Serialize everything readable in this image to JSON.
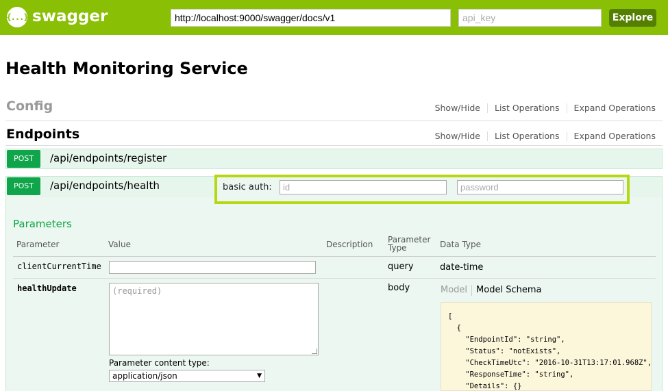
{
  "header": {
    "logo_glyph": "{...}",
    "brand": "swagger",
    "url_value": "http://localhost:9000/swagger/docs/v1",
    "api_key_placeholder": "api_key",
    "explore_label": "Explore",
    "brand_color": "#89bf04"
  },
  "page_title": "Health Monitoring Service",
  "resources": [
    {
      "title": "Config",
      "links": [
        "Show/Hide",
        "List Operations",
        "Expand Operations"
      ]
    },
    {
      "title": "Endpoints",
      "links": [
        "Show/Hide",
        "List Operations",
        "Expand Operations"
      ]
    }
  ],
  "operations": [
    {
      "method": "POST",
      "path": "/api/endpoints/register"
    },
    {
      "method": "POST",
      "path": "/api/endpoints/health"
    }
  ],
  "basic_auth": {
    "label": "basic auth:",
    "id_placeholder": "id",
    "password_placeholder": "password"
  },
  "parameters": {
    "title": "Parameters",
    "headers": [
      "Parameter",
      "Value",
      "Description",
      "Parameter Type",
      "Data Type"
    ],
    "rows": [
      {
        "name": "clientCurrentTime",
        "value": "",
        "description": "",
        "param_type": "query",
        "data_type": "date-time"
      },
      {
        "name": "healthUpdate",
        "placeholder": "(required)",
        "description": "",
        "param_type": "body",
        "data_type": ""
      }
    ],
    "content_type_label": "Parameter content type:",
    "content_type_value": "application/json"
  },
  "model_tabs": [
    "Model",
    "Model Schema"
  ],
  "schema_lines": [
    "[",
    "  {",
    "    \"EndpointId\": \"string\",",
    "    \"Status\": \"notExists\",",
    "    \"CheckTimeUtc\": \"2016-10-31T13:17:01.968Z\",",
    "    \"ResponseTime\": \"string\",",
    "    \"Details\": {}"
  ],
  "colors": {
    "post_green": "#10a54a",
    "op_bg": "#e7f6ec",
    "auth_highlight": "#b6d812",
    "explore_bg": "#547f00"
  }
}
